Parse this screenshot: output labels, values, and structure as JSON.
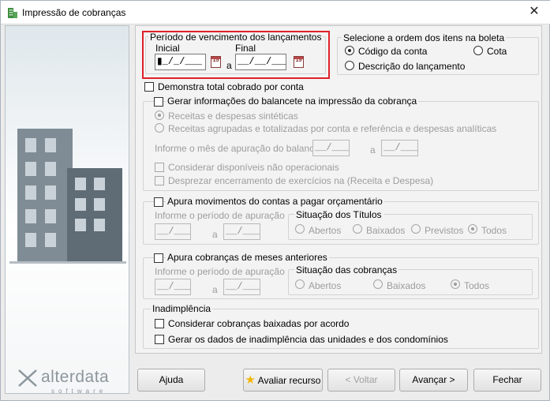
{
  "window": {
    "title": "Impressão de cobranças",
    "close": "✕"
  },
  "brand": {
    "name": "alterdata",
    "sub": "software"
  },
  "vencimento": {
    "legend": "Período de vencimento dos lançamentos",
    "inicial_label": "Inicial",
    "final_label": "Final",
    "inicial_value": "▮_/_/___",
    "final_value": "__/__/____",
    "a": "a"
  },
  "ordem": {
    "legend": "Selecione a ordem dos itens na boleta",
    "codigo": "Código da conta",
    "cota": "Cota",
    "descricao": "Descrição do lançamento",
    "selected": "codigo"
  },
  "demonstra_total": "Demonstra total cobrado por conta",
  "balancete": {
    "check_label": "Gerar informações do balancete na impressão da cobrança",
    "opt1": "Receitas e despesas sintéticas",
    "opt2": "Receitas agrupadas e totalizadas por conta e referência e despesas analíticas",
    "mes_label": "Informe o mês de apuração do balancete",
    "mes_ini": "__/____",
    "mes_fim": "__/____",
    "a": "a",
    "considerar": "Considerar disponíveis não operacionais",
    "desprezar": "Desprezar encerramento de exercícios na (Receita e Despesa)"
  },
  "apura_pagar": {
    "check_label": "Apura movimentos do contas a pagar orçamentário",
    "periodo_label": "Informe o período de apuração",
    "ini": "__/____",
    "fim": "__/____",
    "a": "a",
    "situacao_legend": "Situação dos Títulos",
    "abertos": "Abertos",
    "baixados": "Baixados",
    "previstos": "Previstos",
    "todos": "Todos"
  },
  "apura_anteriores": {
    "check_label": "Apura cobranças de meses anteriores",
    "periodo_label": "Informe o período de apuração",
    "ini": "__/____",
    "fim": "__/____",
    "a": "a",
    "situacao_legend": "Situação das cobranças",
    "abertos": "Abertos",
    "baixados": "Baixados",
    "todos": "Todos"
  },
  "inadimplencia": {
    "legend": "Inadimplência",
    "opt1": "Considerar cobranças baixadas por acordo",
    "opt2": "Gerar os dados de inadimplência das unidades e dos condomínios"
  },
  "buttons": {
    "ajuda": "Ajuda",
    "avaliar": "Avaliar recurso",
    "voltar": "< Voltar",
    "avancar": "Avançar >",
    "fechar": "Fechar"
  },
  "colors": {
    "highlight": "#e0202a",
    "accent_star": "#f2b705"
  }
}
